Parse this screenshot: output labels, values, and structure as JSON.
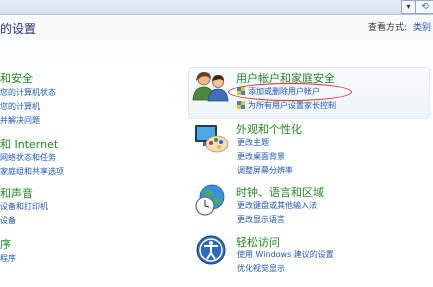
{
  "window": {
    "address_dropdown_glyph": "▾",
    "refresh_glyph": "⟲"
  },
  "header": {
    "title": "的设置",
    "view_by_label": "查看方式:",
    "view_by_value": "类别"
  },
  "left_column": {
    "categories": [
      {
        "title": "和安全",
        "links": [
          "您的计算机状态",
          "您的计算机",
          "并解决问题"
        ]
      },
      {
        "title": "和 Internet",
        "links": [
          "网络状态和任务",
          "家庭组和共享选项"
        ]
      },
      {
        "title": "和声音",
        "links": [
          "设备和打印机",
          "设备"
        ]
      },
      {
        "title": "序",
        "links": [
          "程序"
        ]
      }
    ]
  },
  "right_column": {
    "categories": [
      {
        "title": "用户帐户和家庭安全",
        "icon": "users-icon",
        "links": [
          "添加或删除用户帐户",
          "为所有用户设置家长控制"
        ],
        "link_icons": [
          "shield-icon",
          "shield-icon"
        ]
      },
      {
        "title": "外观和个性化",
        "icon": "monitor-palette-icon",
        "links": [
          "更改主题",
          "更改桌面背景",
          "调整屏幕分辨率"
        ]
      },
      {
        "title": "时钟、语言和区域",
        "icon": "globe-clock-icon",
        "links": [
          "更改键盘或其他输入法",
          "更改显示语言"
        ]
      },
      {
        "title": "轻松访问",
        "icon": "accessibility-icon",
        "links": [
          "使用 Windows 建议的设置",
          "优化视觉显示"
        ]
      }
    ]
  },
  "colors": {
    "category_title": "#1e8a1e",
    "link": "#1e56b6",
    "highlight": "#e03030"
  }
}
